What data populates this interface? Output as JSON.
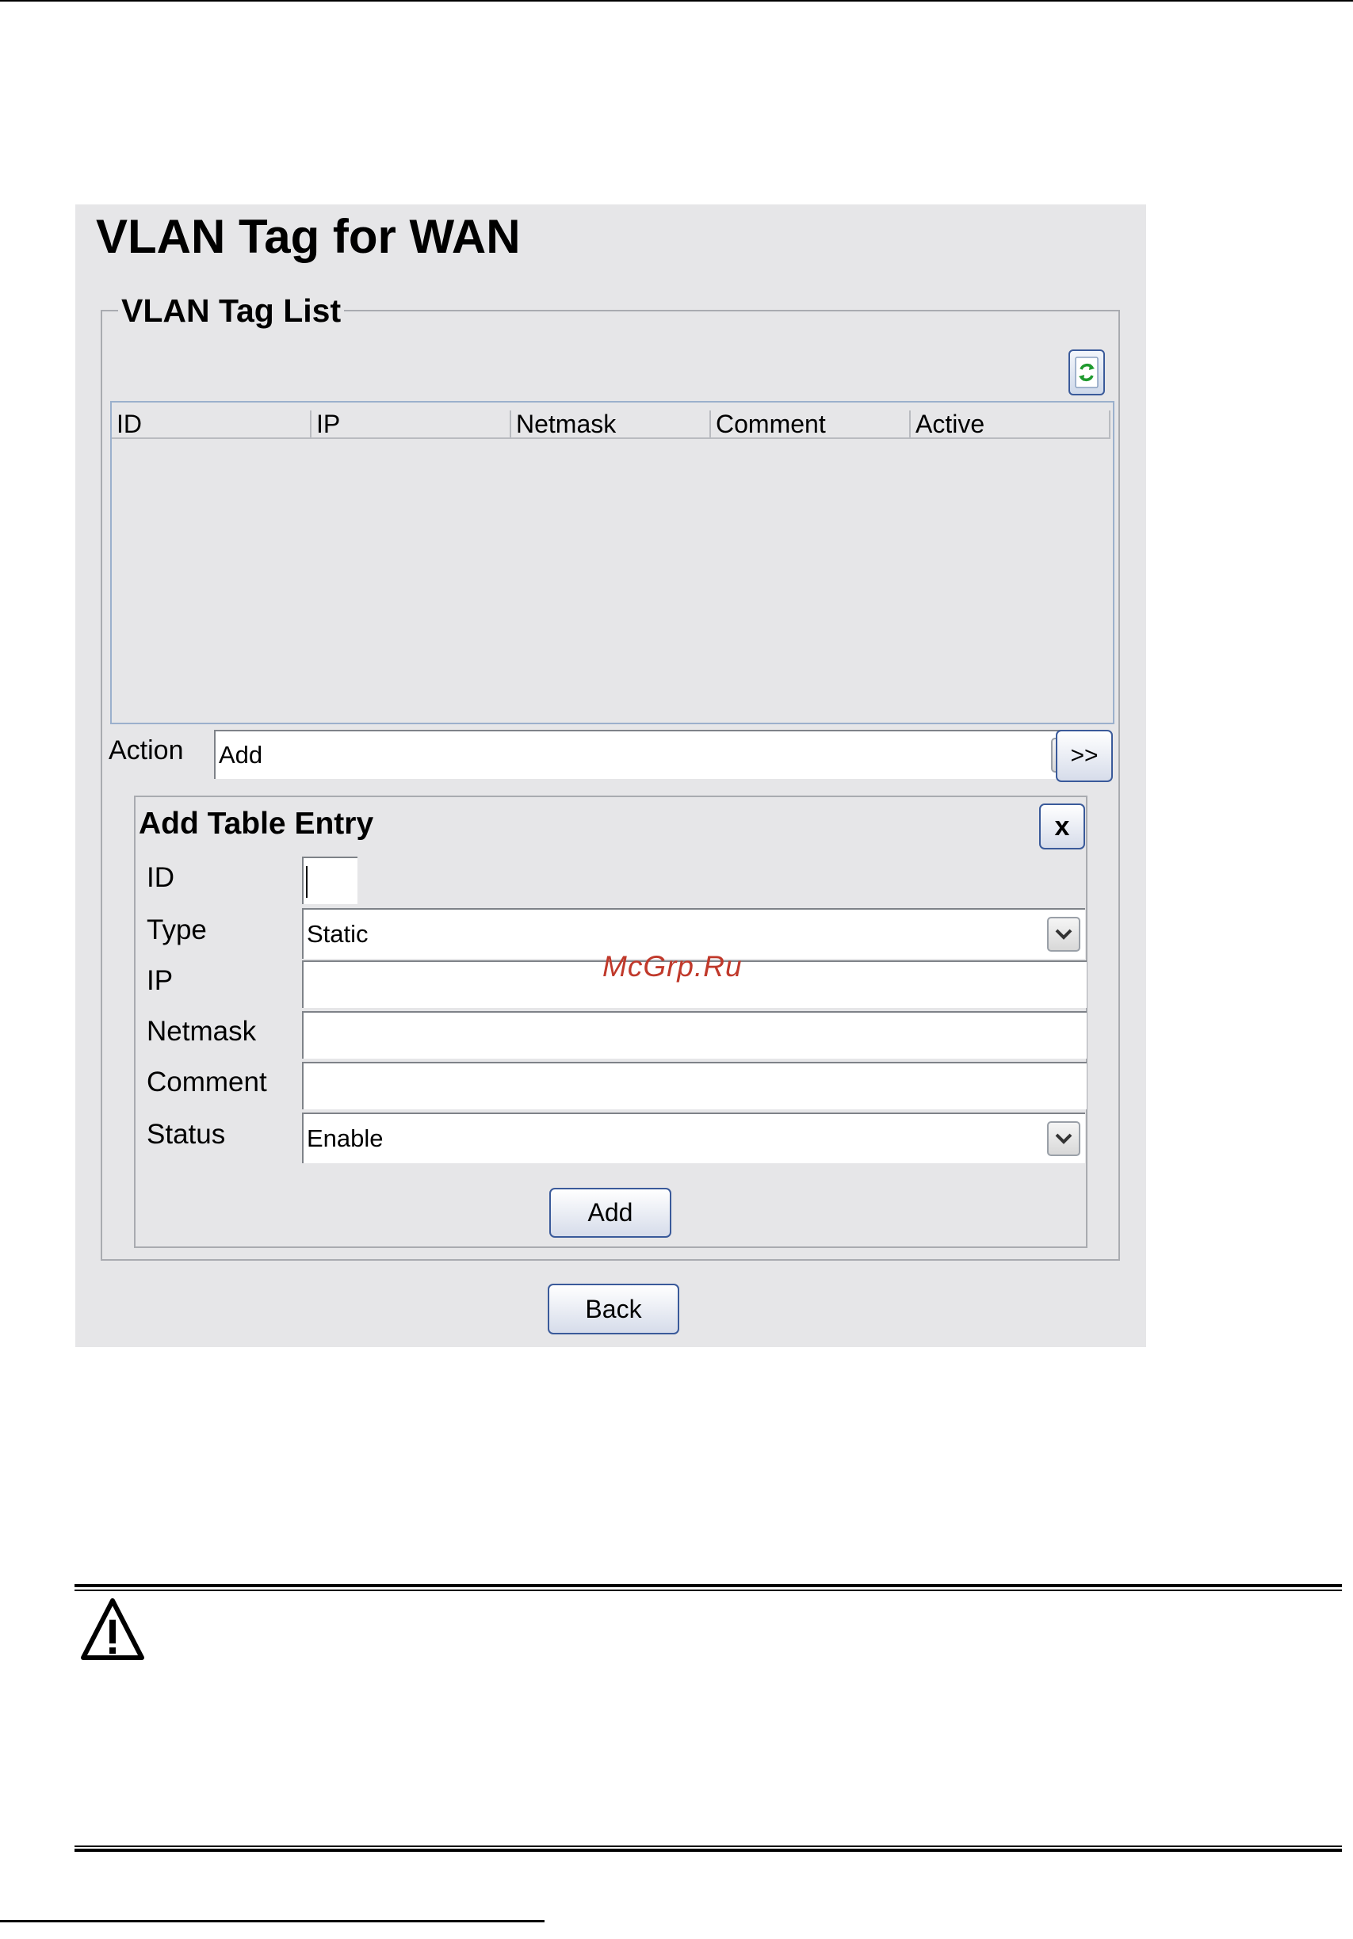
{
  "page": {
    "title": "VLAN Tag for WAN",
    "watermark": "McGrp.Ru"
  },
  "list": {
    "legend": "VLAN Tag List",
    "refresh_icon": "refresh-icon",
    "columns": [
      "ID",
      "IP",
      "Netmask",
      "Comment",
      "Active"
    ],
    "rows": []
  },
  "action": {
    "label": "Action",
    "selected": "Add",
    "go_label": ">>"
  },
  "entry_form": {
    "title": "Add Table Entry",
    "close_label": "x",
    "fields": {
      "id": {
        "label": "ID",
        "value": ""
      },
      "type": {
        "label": "Type",
        "selected": "Static"
      },
      "ip": {
        "label": "IP",
        "value": ""
      },
      "netmask": {
        "label": "Netmask",
        "value": ""
      },
      "comment": {
        "label": "Comment",
        "value": ""
      },
      "status": {
        "label": "Status",
        "selected": "Enable"
      }
    },
    "add_label": "Add"
  },
  "footer": {
    "back_label": "Back"
  },
  "note": {
    "icon": "warning-icon"
  },
  "colors": {
    "panel_bg": "#e6e6e8",
    "button_border": "#3a5a9a",
    "watermark": "#c0392b"
  }
}
